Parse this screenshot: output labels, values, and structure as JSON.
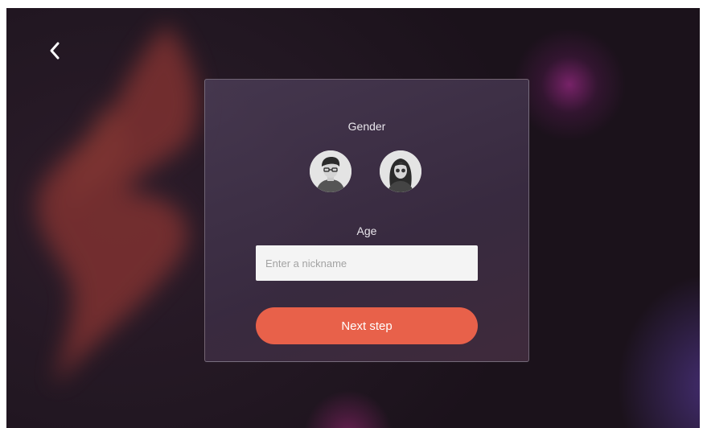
{
  "navigation": {
    "back_icon": "chevron-left-icon"
  },
  "form": {
    "gender_label": "Gender",
    "options": [
      {
        "value": "male",
        "icon": "male-avatar-icon"
      },
      {
        "value": "female",
        "icon": "female-avatar-icon"
      }
    ],
    "age_label": "Age",
    "input_placeholder": "Enter a nickname",
    "input_value": "",
    "submit_label": "Next step"
  },
  "colors": {
    "accent": "#e8614a",
    "background": "#221722",
    "card": "#3f3049",
    "text": "#e9e6ec"
  }
}
